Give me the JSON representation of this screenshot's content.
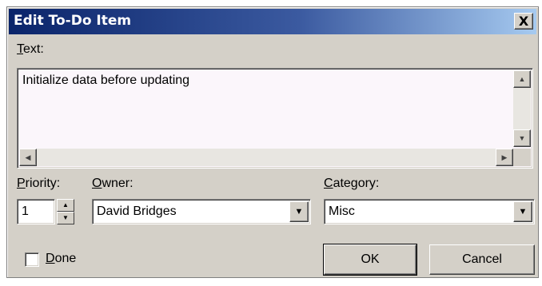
{
  "window": {
    "title": "Edit To-Do Item",
    "close_glyph": "X"
  },
  "text_field": {
    "label_accel": "T",
    "label_rest": "ext:",
    "value": "Initialize data before updating"
  },
  "priority": {
    "label_accel": "P",
    "label_rest": "riority:",
    "value": "1"
  },
  "owner": {
    "label_accel": "O",
    "label_rest": "wner:",
    "value": "David Bridges"
  },
  "category": {
    "label_accel": "C",
    "label_rest": "ategory:",
    "value": "Misc"
  },
  "done": {
    "label_accel": "D",
    "label_rest": "one",
    "checked": false
  },
  "buttons": {
    "ok": "OK",
    "cancel": "Cancel"
  },
  "colors": {
    "titlebar_start": "#0a246a",
    "titlebar_end": "#a6caf0",
    "dialog_face": "#d4d0c8"
  },
  "icons": {
    "scroll_up": "up-arrow-icon",
    "scroll_down": "down-arrow-icon",
    "scroll_left": "left-arrow-icon",
    "scroll_right": "right-arrow-icon",
    "dropdown": "chevron-down-icon"
  }
}
